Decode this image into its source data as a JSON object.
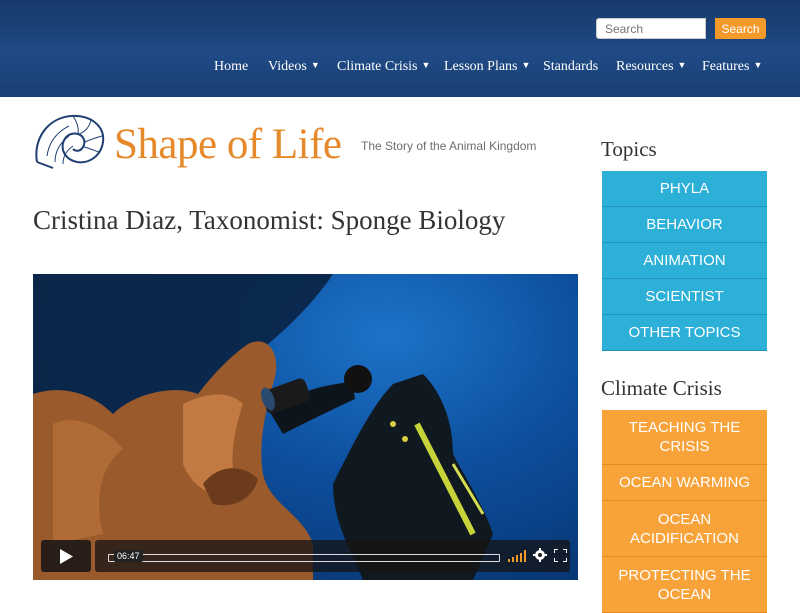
{
  "search": {
    "placeholder": "Search",
    "button_label": "Search"
  },
  "nav": {
    "items": [
      {
        "label": "Home",
        "has_dropdown": false
      },
      {
        "label": "Videos",
        "has_dropdown": true
      },
      {
        "label": "Climate Crisis",
        "has_dropdown": true
      },
      {
        "label": "Lesson Plans",
        "has_dropdown": true
      },
      {
        "label": "Standards",
        "has_dropdown": false
      },
      {
        "label": "Resources",
        "has_dropdown": true
      },
      {
        "label": "Features",
        "has_dropdown": true
      }
    ],
    "caret_glyph": "▼"
  },
  "logo": {
    "name": "Shape of Life",
    "tagline": "The Story of the Animal Kingdom",
    "icon": "nautilus-shell-icon"
  },
  "page": {
    "title": "Cristina Diaz, Taxonomist: Sponge Biology"
  },
  "video": {
    "duration": "06:47",
    "progress": 0,
    "icons": [
      "play-icon",
      "volume-icon",
      "settings-icon",
      "fullscreen-icon"
    ]
  },
  "sidebar": {
    "topics_heading": "Topics",
    "topics": [
      "PHYLA",
      "BEHAVIOR",
      "ANIMATION",
      "SCIENTIST",
      "OTHER TOPICS"
    ],
    "climate_heading": "Climate Crisis",
    "climate": [
      "TEACHING THE CRISIS",
      "OCEAN WARMING",
      "OCEAN ACIDIFICATION",
      "PROTECTING THE OCEAN"
    ]
  },
  "colors": {
    "header": "#1f4a85",
    "accent_orange": "#f39a2b",
    "topic_blue": "#2cb0d8",
    "climate_orange": "#f8a33a",
    "logo_orange": "#e5892b"
  }
}
